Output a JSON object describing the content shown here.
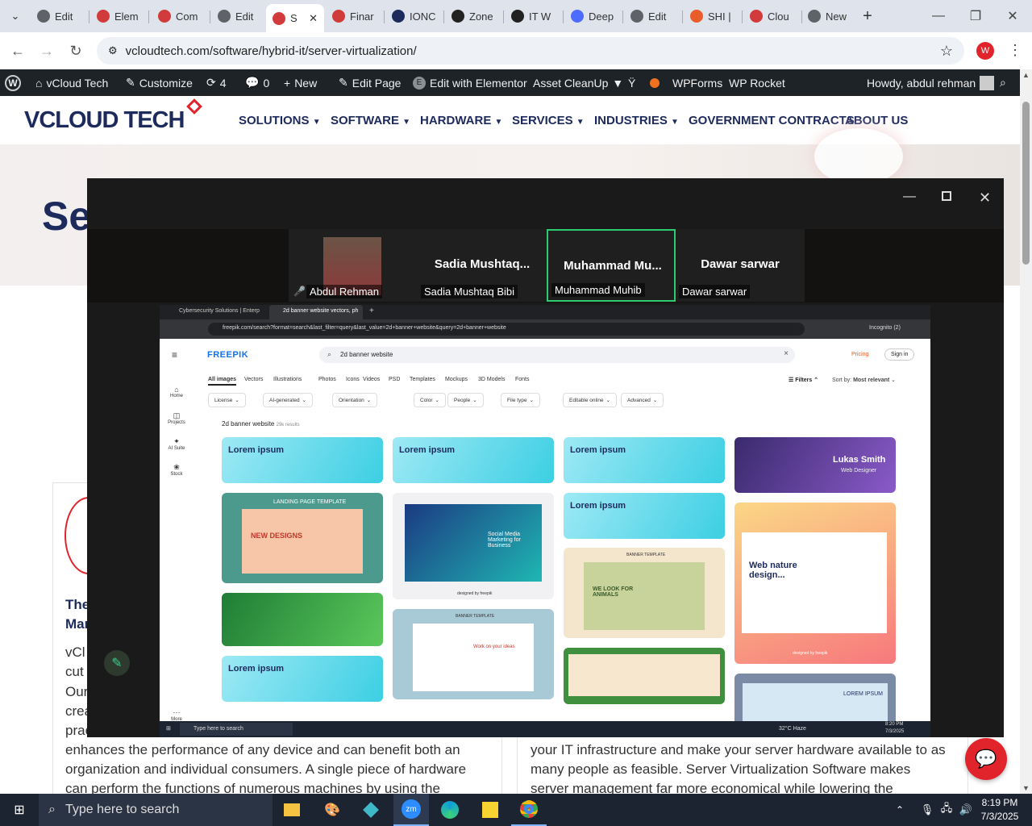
{
  "browser": {
    "tabs": [
      {
        "label": "Edit",
        "color": "#5f6368"
      },
      {
        "label": "Elem",
        "color": "#d23b3b"
      },
      {
        "label": "Com",
        "color": "#d23b3b"
      },
      {
        "label": "Edit",
        "color": "#5f6368"
      },
      {
        "label": "S",
        "color": "#d23b3b"
      },
      {
        "label": "Finar",
        "color": "#d23b3b"
      },
      {
        "label": "IONC",
        "color": "#1d2a5c"
      },
      {
        "label": "Zone",
        "color": "#222222"
      },
      {
        "label": "IT W",
        "color": "#222222"
      },
      {
        "label": "Deep",
        "color": "#4d6bfe"
      },
      {
        "label": "Edit",
        "color": "#5f6368"
      },
      {
        "label": "SHI |",
        "color": "#e85d2a"
      },
      {
        "label": "Clou",
        "color": "#d23b3b"
      },
      {
        "label": "New",
        "color": "#5f6368"
      }
    ],
    "url": "vcloudtech.com/software/hybrid-it/server-virtualization/",
    "profile_initial": "W"
  },
  "wpbar": {
    "site": "vCloud Tech",
    "customize": "Customize",
    "updates": "4",
    "comments": "0",
    "new": "New",
    "edit_page": "Edit Page",
    "elementor": "Edit with Elementor",
    "asset": "Asset CleanUp",
    "wpforms": "WPForms",
    "rocket": "WP Rocket",
    "howdy": "Howdy, abdul rehman"
  },
  "site": {
    "logo": "VCLOUD TECH",
    "menu": [
      "SOLUTIONS",
      "SOFTWARE",
      "HARDWARE",
      "SERVICES",
      "INDUSTRIES",
      "GOVERNMENT CONTRACTS",
      "ABOUT US"
    ],
    "hero_title": "Se",
    "left_heading": [
      "The",
      "Mar"
    ],
    "left_lines": [
      "vCl",
      "cut",
      "Our",
      "crea",
      "prac",
      "enhances the performance of any device and can benefit both an",
      "organization and individual consumers. A single piece of hardware",
      "can perform the functions of numerous machines by using the"
    ],
    "right_lines": [
      "your IT infrastructure and make your server hardware available to as",
      "many people as feasible. Server Virtualization Software makes",
      "server management far more economical while lowering the"
    ]
  },
  "zoom": {
    "participants": [
      {
        "name": "",
        "label": "Abdul Rehman"
      },
      {
        "name": "Sadia  Mushtaq...",
        "label": "Sadia Mushtaq Bibi"
      },
      {
        "name": "Muhammad  Mu...",
        "label": "Muhammad Muhib"
      },
      {
        "name": "Dawar sarwar",
        "label": "Dawar sarwar"
      }
    ]
  },
  "shared": {
    "tab1": "Cybersecurity Solutions | Enterp",
    "tab2": "2d banner website vectors, ph",
    "url": "freepik.com/search?format=search&last_filter=query&last_value=2d+banner+website&query=2d+banner+website",
    "incognito": "Incognito (2)",
    "logo": "FREEPIK",
    "search": "2d banner website",
    "pricing": "Pricing",
    "signin": "Sign in",
    "side": [
      "Home",
      "Projects",
      "AI Suite",
      "Stock",
      "More"
    ],
    "cats": [
      "All images",
      "Vectors",
      "Illustrations",
      "Photos",
      "Icons",
      "Videos",
      "PSD",
      "Templates",
      "Mockups",
      "3D Models",
      "Fonts"
    ],
    "filters": "Filters",
    "sortby": "Sort by:",
    "sortval": "Most relevant",
    "chips": [
      "License",
      "AI-generated",
      "Orientation",
      "Color",
      "People",
      "File type",
      "Editable online",
      "Advanced"
    ],
    "results_title": "2d banner website",
    "results_count": "29k results",
    "lorem": "Lorem ipsum",
    "lukas": "Lukas Smith",
    "lukas_sub": "Web Designer",
    "landing": "LANDING PAGE TEMPLATE",
    "new_designs": "NEW DESIGNS",
    "social": "Social Media Marketing for Business",
    "look": "WE LOOK FOR ANIMALS",
    "banner_tpl": "BANNER TEMPLATE",
    "work": "Work on your ideas",
    "web_nature": "Web nature design...",
    "lorem_caps": "LOREM IPSUM",
    "designed": "designed by freepik",
    "task_search": "Type here to search",
    "weather": "32°C Haze",
    "time": "8:20 PM",
    "date": "7/3/2025"
  },
  "taskbar": {
    "search": "Type here to search",
    "time": "8:19 PM",
    "date": "7/3/2025"
  },
  "colors": {
    "brand": "#1d2a5c",
    "accent": "#e1232b",
    "zoom_active": "#2ecc71",
    "wp": "#1d2327"
  }
}
